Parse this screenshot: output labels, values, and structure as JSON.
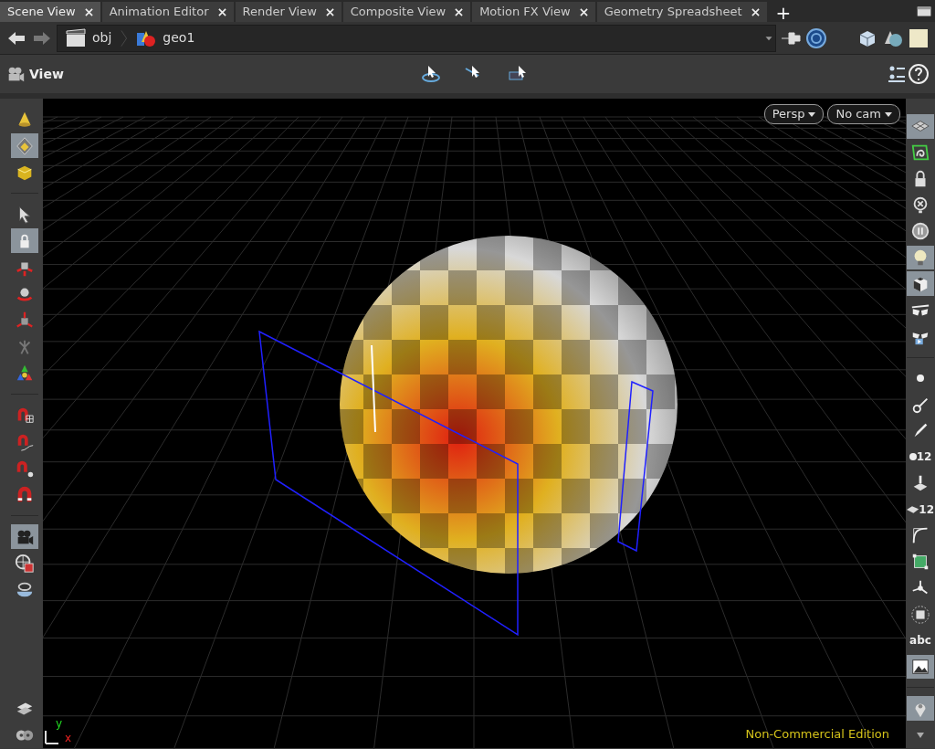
{
  "tabs": [
    {
      "label": "Scene View",
      "selected": true
    },
    {
      "label": "Animation Editor",
      "selected": false
    },
    {
      "label": "Render View",
      "selected": false
    },
    {
      "label": "Composite View",
      "selected": false
    },
    {
      "label": "Motion FX View",
      "selected": false
    },
    {
      "label": "Geometry Spreadsheet",
      "selected": false
    }
  ],
  "new_tab": "+",
  "path": [
    "obj",
    "geo1"
  ],
  "pane": {
    "title": "View"
  },
  "viewport": {
    "buttons": [
      "Persp",
      "No cam"
    ],
    "axis_labels": [
      "y",
      "x"
    ],
    "edition": "Non-Commercial Edition"
  },
  "left_toolbar": [
    [
      {
        "kind": "cone",
        "selected": false
      },
      {
        "kind": "diamond",
        "selected": true
      },
      {
        "kind": "cube",
        "selected": false
      }
    ],
    [
      {
        "kind": "arrow-cursor",
        "selected": false
      },
      {
        "kind": "padlock-cursor",
        "selected": true
      },
      {
        "kind": "cube-arrows",
        "selected": false
      },
      {
        "kind": "sphere-arrows",
        "selected": false
      },
      {
        "kind": "axis-handle",
        "selected": false
      },
      {
        "kind": "skeleton",
        "selected": false
      },
      {
        "kind": "triad",
        "selected": false
      }
    ],
    [
      {
        "kind": "magnet-grid",
        "selected": false
      },
      {
        "kind": "magnet-curve",
        "selected": false
      },
      {
        "kind": "magnet-dot",
        "selected": false
      },
      {
        "kind": "magnet",
        "selected": false
      }
    ],
    [
      {
        "kind": "camera",
        "selected": true
      },
      {
        "kind": "globe",
        "selected": false
      },
      {
        "kind": "lens",
        "selected": false
      }
    ]
  ],
  "left_bottom": [
    {
      "kind": "sheets",
      "selected": false
    },
    {
      "kind": "reels",
      "selected": false
    }
  ],
  "right_toolbar": [
    [
      {
        "kind": "grid-plane",
        "selected": true
      },
      {
        "kind": "curve-loop",
        "selected": false
      },
      {
        "kind": "padlock",
        "selected": false
      },
      {
        "kind": "bulb-cross",
        "selected": false
      },
      {
        "kind": "disc",
        "selected": false
      },
      {
        "kind": "bulb",
        "selected": true
      },
      {
        "kind": "checker-cube",
        "selected": true
      },
      {
        "kind": "glasses",
        "selected": false
      },
      {
        "kind": "glasses-play",
        "selected": false
      }
    ],
    [
      {
        "kind": "dot",
        "selected": false
      },
      {
        "kind": "brush",
        "selected": false
      },
      {
        "kind": "pen",
        "selected": false
      },
      {
        "kind": "dot",
        "text": "12",
        "selected": false
      },
      {
        "kind": "paint",
        "selected": false
      },
      {
        "kind": "sheet",
        "text": "12",
        "selected": false
      },
      {
        "kind": "corner-curve",
        "selected": false
      },
      {
        "kind": "square-points",
        "selected": false
      },
      {
        "kind": "tri-axis",
        "selected": false
      },
      {
        "kind": "circle-lines",
        "selected": false
      },
      {
        "kind": "text",
        "text": "abc",
        "selected": false
      },
      {
        "kind": "picture",
        "selected": true
      }
    ],
    [
      {
        "kind": "map-pin",
        "selected": true
      },
      {
        "kind": "caret",
        "selected": false
      }
    ]
  ]
}
